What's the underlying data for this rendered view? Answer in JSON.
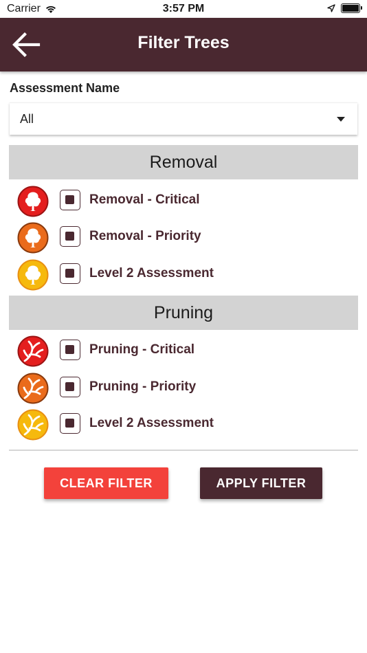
{
  "status_bar": {
    "carrier": "Carrier",
    "time": "3:57 PM"
  },
  "app_bar": {
    "title": "Filter Trees",
    "back_icon": "back-arrow-icon"
  },
  "assessment": {
    "label": "Assessment Name",
    "selected": "All"
  },
  "sections": [
    {
      "title": "Removal",
      "items": [
        {
          "label": "Removal - Critical",
          "icon": "tree-icon",
          "color": "#e41e1e",
          "checked": true
        },
        {
          "label": "Removal - Priority",
          "icon": "tree-icon",
          "color": "#ea6b1b",
          "checked": true
        },
        {
          "label": "Level 2 Assessment",
          "icon": "tree-icon",
          "color": "#f6b90d",
          "checked": true
        }
      ]
    },
    {
      "title": "Pruning",
      "items": [
        {
          "label": "Pruning - Critical",
          "icon": "branch-icon",
          "color": "#e41e1e",
          "checked": true
        },
        {
          "label": "Pruning - Priority",
          "icon": "branch-icon",
          "color": "#ea6b1b",
          "checked": true
        },
        {
          "label": "Level 2 Assessment",
          "icon": "branch-icon",
          "color": "#f6b90d",
          "checked": true
        }
      ]
    }
  ],
  "buttons": {
    "clear": "CLEAR FILTER",
    "apply": "APPLY FILTER"
  },
  "colors": {
    "primary": "#4a2830",
    "clear_button": "#f3423b",
    "apply_button": "#4a2830",
    "section_header": "#d3d3d3"
  }
}
